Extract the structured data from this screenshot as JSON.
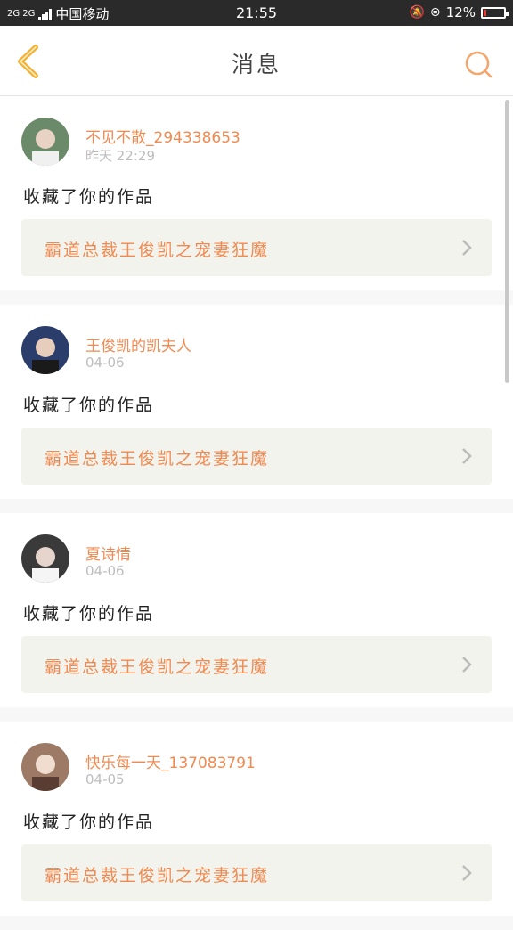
{
  "status": {
    "network": "2G 2G",
    "carrier": "中国移动",
    "time": "21:55",
    "battery": "12%",
    "battery_level": 0.12
  },
  "header": {
    "title": "消息",
    "back_icon": "chevron-left-icon",
    "search_icon": "search-icon",
    "accent_color": "#f2b23a"
  },
  "messages": [
    {
      "user": "不见不散_294338653",
      "date": "昨天 22:29",
      "action": "收藏了你的作品",
      "work": "霸道总裁王俊凯之宠妻狂魔",
      "avatar_color": "#6b8a6a"
    },
    {
      "user": "王俊凯的凯夫人",
      "date": "04-06",
      "action": "收藏了你的作品",
      "work": "霸道总裁王俊凯之宠妻狂魔",
      "avatar_color": "#2b3d6b"
    },
    {
      "user": "夏诗情",
      "date": "04-06",
      "action": "收藏了你的作品",
      "work": "霸道总裁王俊凯之宠妻狂魔",
      "avatar_color": "#3a3a3a"
    },
    {
      "user": "快乐每一天_137083791",
      "date": "04-05",
      "action": "收藏了你的作品",
      "work": "霸道总裁王俊凯之宠妻狂魔",
      "avatar_color": "#9c7a66"
    }
  ]
}
